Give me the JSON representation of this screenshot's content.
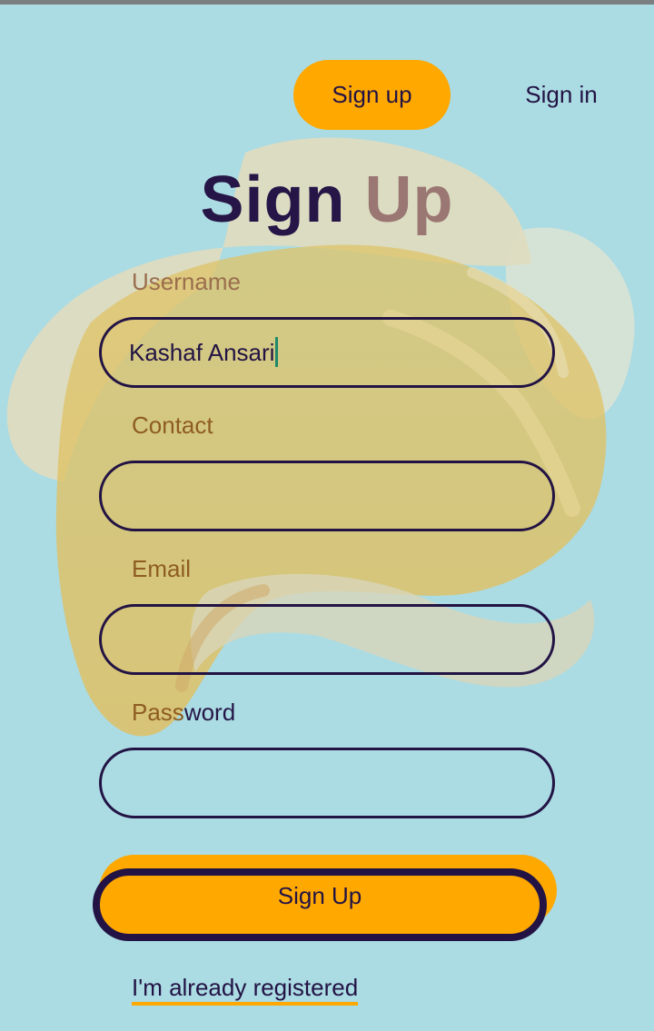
{
  "nav": {
    "signup_label": "Sign up",
    "signin_label": "Sign in"
  },
  "form": {
    "title": "Sign Up",
    "username": {
      "label": "Username",
      "value": "Kashaf Ansari"
    },
    "contact": {
      "label": "Contact",
      "value": ""
    },
    "email": {
      "label": "Email",
      "value": ""
    },
    "password": {
      "label_part1": "Pass",
      "label_part2": "word",
      "value": ""
    },
    "submit_label": "Sign Up",
    "login_link": "I'm already registered"
  },
  "colors": {
    "background": "#abdbe3",
    "accent": "#ffa800",
    "dark": "#221344",
    "label_brown": "#8e5c21"
  }
}
